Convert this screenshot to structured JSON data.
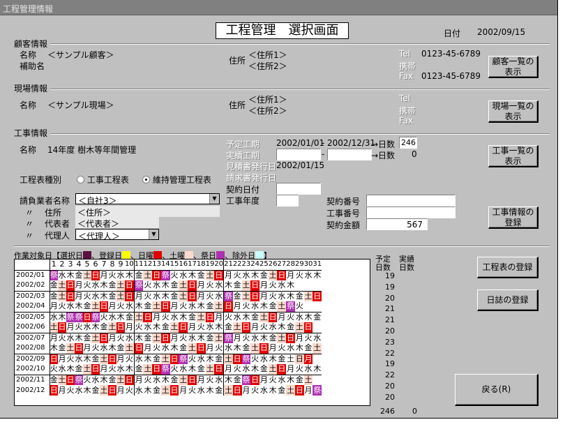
{
  "window": {
    "title": "工程管理情報"
  },
  "header": {
    "title": "工程管理　選択画面",
    "date_label": "日付",
    "date_value": "2002/09/15"
  },
  "customer": {
    "section": "顧客情報",
    "name_label": "名称",
    "name_value": "＜サンプル顧客＞",
    "aux_label": "補助名",
    "address_label": "住所",
    "address1": "＜住所1＞",
    "address2": "＜住所2＞",
    "tel_label": "Tel",
    "tel_value": "0123-45-6789",
    "mobile_label": "携帯",
    "fax_label": "Fax",
    "fax_value": "0123-45-6789",
    "list_button": "顧客一覧の\n表示"
  },
  "site": {
    "section": "現場情報",
    "name_label": "名称",
    "name_value": "＜サンプル現場＞",
    "address_label": "住所",
    "address1": "＜住所1＞",
    "address2": "＜住所2＞",
    "tel_label": "Tel",
    "mobile_label": "携帯",
    "fax_label": "Fax",
    "list_button": "現場一覧の\n表示"
  },
  "work": {
    "section": "工事情報",
    "name_label": "名称",
    "name_value": "14年度 樹木等年間管理",
    "plan_label": "予定工期",
    "plan_start": "2002/01/01",
    "dash": "-",
    "plan_end": "2002/12/31",
    "days_arrow": "→日数",
    "plan_days": "246",
    "actual_label": "実績工期",
    "actual_days": "0",
    "estimate_label": "見積書発行日",
    "estimate_date": "2002/01/15",
    "invoice_label": "請求書発行日",
    "contract_date_label": "契約日付",
    "work_year_label": "工事年度",
    "contract_no_label": "契約番号",
    "work_no_label": "工事番号",
    "contract_amount_label": "契約金額",
    "contract_amount": "567",
    "list_button": "工事一覧の\n表示",
    "register_button": "工事情報の\n登録",
    "schedule_type_label": "工程表種別",
    "schedule_opt1": "工事工程表",
    "schedule_opt2": "維持管理工程表",
    "schedule_selected": "維持管理工程表",
    "contractor_label": "請負業者名称",
    "contractor_value": "＜自社3＞",
    "ditto": "〃",
    "c_address_label": "住所",
    "c_address": "＜住所＞",
    "c_rep_label": "代表者",
    "c_rep": "＜代表者＞",
    "c_agent_label": "代理人",
    "c_agent": "＜代理人＞"
  },
  "calendar": {
    "legend_prefix": "作業対象日【選択日",
    "legend_registered": "、登録日",
    "legend_sunday": "、日曜",
    "legend_saturday": "、土曜",
    "legend_holiday": "、祭日",
    "legend_excluded": "、除外日",
    "legend_suffix": "】",
    "colors": {
      "selected": "#5a1040",
      "registered": "#ffff00",
      "sunday": "#e00000",
      "saturday": "#fcd9cc",
      "holiday": "#b030b0",
      "excluded": "#c8ffff"
    },
    "planned_header": "予定\n日数",
    "actual_header": "実績\n日数",
    "day_headers": [
      "1",
      "2",
      "3",
      "4",
      "5",
      "6",
      "7",
      "8",
      "9",
      "10",
      "11",
      "12",
      "13",
      "14",
      "15",
      "16",
      "17",
      "18",
      "19",
      "20",
      "21",
      "22",
      "23",
      "24",
      "25",
      "26",
      "27",
      "28",
      "29",
      "30",
      "31"
    ],
    "months": [
      {
        "label": "2002/01",
        "days": "祭水木金土日月火水木金土日祭火水木金土日月火水木金土日月火水木",
        "types": "HNNNSUNNNNNSUHNNNNSUNNNNNSUNNNN",
        "planned": "19"
      },
      {
        "label": "2002/02",
        "days": "金土日月火水木金土日祭火水木金土日月火水木金土日月火水木",
        "types": "NSUNNNNNSUHNNNNSUNNNNNSUNNNN",
        "planned": "19"
      },
      {
        "label": "2002/03",
        "days": "金土日月火水木金土日月火水木金土日月火水祭金土日月火水木金土日",
        "types": "NSUNNNNNSUNNNNNSUNNNHNSUNNNNNSU",
        "planned": "20"
      },
      {
        "label": "2002/04",
        "days": "月火水木金土日月火水木金土日月火水木金土日月火水木金土祭火",
        "types": "NNNNNSUNNNNNSUNNNNNSUNNNNNSHN",
        "planned": "21"
      },
      {
        "label": "2002/05",
        "days": "水木祭祭日祭火水木金土日月火水木金土日月火水木金土日月火水木金",
        "types": "NNHHUHNNNNSUNNNNNSUNNNNNSUNNNNN",
        "planned": "21"
      },
      {
        "label": "2002/06",
        "days": "土日月火水木金土日月火水木金土日月火水木金土日月火水木金土日",
        "types": "SUNNNNNSUNNNNNSUNNNNNSUNNNNNSU",
        "planned": "20"
      },
      {
        "label": "2002/07",
        "days": "月火水木金土日月火水木金土日月火水木金土祭月火水木金土日月火水",
        "types": "NNNNNSUNNNNNSUNNNNNSHNNNNNSUNNN",
        "planned": "23"
      },
      {
        "label": "2002/08",
        "days": "木金土日月火水木金土日月火水木金土日月火水木金土日月火水木金土",
        "types": "NNSUNNNNNSUNNNNNSUNNNNNSUNNNNNS",
        "planned": "22"
      },
      {
        "label": "2002/09",
        "days": "日月火水木金土日月火水木金土日祭火水木金土日祭火水木金土日月",
        "types": "UNNNNNSUNNNNNSUHNNNNSUHNNNNNSUN",
        "planned": "19"
      },
      {
        "label": "2002/10",
        "days": "火水木金土日月火水木金土日祭火水木金土日月火水木金土日月火水木",
        "types": "NNNNSUNNNNNSUHNNNNSUNNNNNSUNNNN",
        "planned": "22"
      },
      {
        "label": "2002/11",
        "days": "金土日祭火水木金土日月火水木金土日月火水木金祭日月火水木金土",
        "types": "NSUHNNNNSUNNNNNSUNNNNNHUNNNNNS",
        "planned": "20"
      },
      {
        "label": "2002/12",
        "days": "日月火水木金土日月火水木金土日月火水木金土日月火水木金土日月祭",
        "types": "UNNNNNSUNNNNNSUNNNNNSUNNNNNSUNH",
        "planned": "20"
      }
    ],
    "total_planned": "246",
    "total_actual": "0"
  },
  "buttons": {
    "register_schedule": "工程表の登録",
    "register_diary": "日誌の登録",
    "back": "戻る(R)"
  }
}
